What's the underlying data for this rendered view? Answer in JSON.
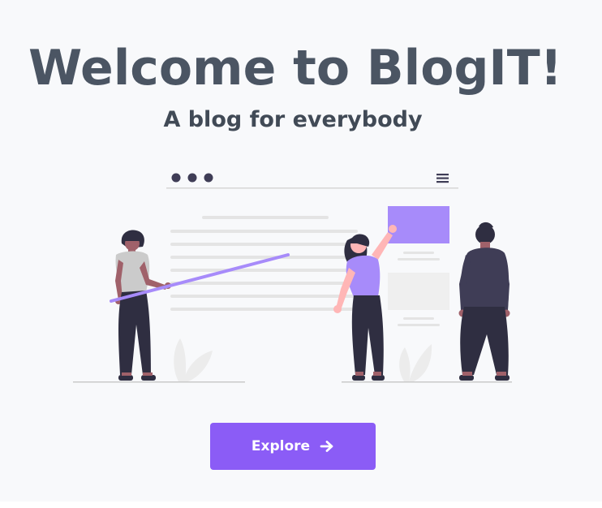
{
  "hero": {
    "title": "Welcome to BlogIT!",
    "subtitle": "A blog for everybody"
  },
  "explore_button": {
    "label": "Explore",
    "icon": "arrow-right-icon"
  },
  "illustration": {
    "description_icon": "blog-team-illustration"
  },
  "colors": {
    "background": "#f8f9fb",
    "title": "#4b5563",
    "accent": "#8b5cf6",
    "accent_light": "#a78bfa",
    "dark": "#3f3d56",
    "skin": "#a0616a",
    "pink_skin": "#ffb6b6"
  }
}
